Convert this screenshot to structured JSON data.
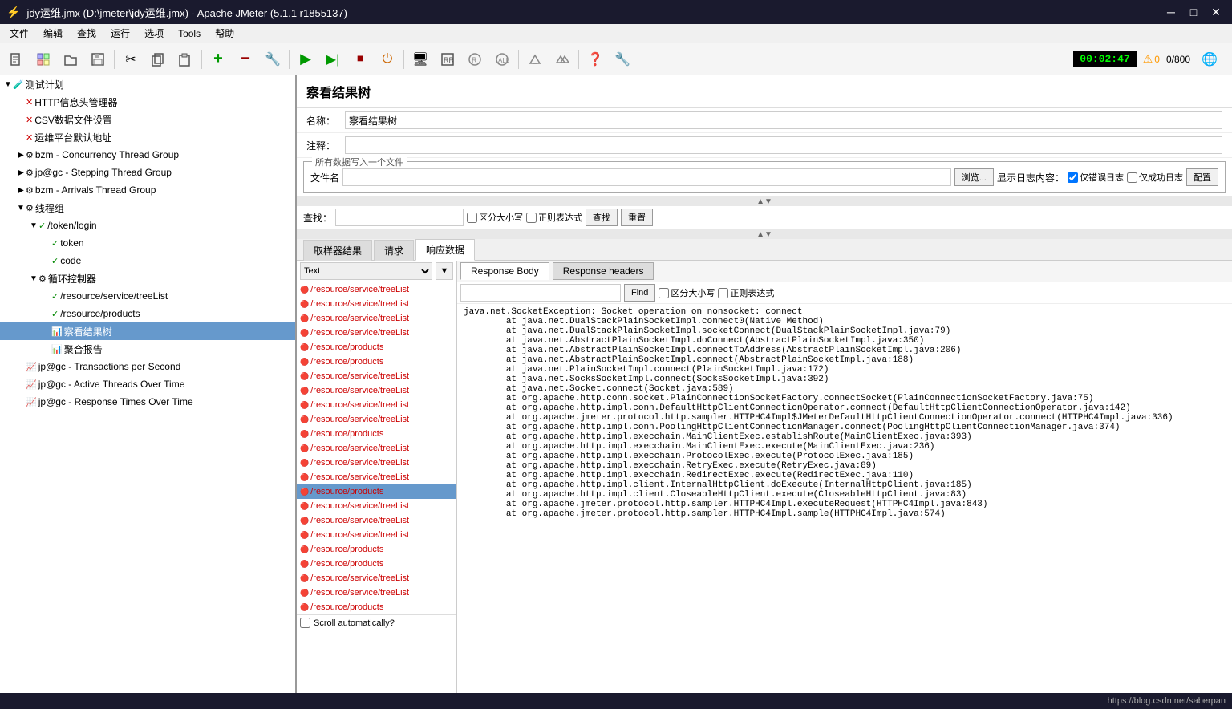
{
  "titleBar": {
    "icon": "⚡",
    "title": "jdy运维.jmx (D:\\jmeter\\jdy运维.jmx) - Apache JMeter (5.1.1 r1855137)",
    "minimize": "─",
    "maximize": "□",
    "close": "✕"
  },
  "menuBar": {
    "items": [
      "文件",
      "编辑",
      "查找",
      "运行",
      "选项",
      "Tools",
      "帮助"
    ]
  },
  "toolbar": {
    "timer": "00:02:47",
    "warningCount": "0",
    "counter": "0/800"
  },
  "sidebar": {
    "items": [
      {
        "id": "test-plan",
        "label": "测试计划",
        "level": 0,
        "icon": "🧪",
        "expanded": true
      },
      {
        "id": "http-header",
        "label": "HTTP信息头管理器",
        "level": 1,
        "icon": "✕",
        "type": "error"
      },
      {
        "id": "csv-data",
        "label": "CSV数据文件设置",
        "level": 1,
        "icon": "✕",
        "type": "error"
      },
      {
        "id": "user-defaults",
        "label": "运维平台默认地址",
        "level": 1,
        "icon": "✕",
        "type": "error"
      },
      {
        "id": "bzm-concurrency",
        "label": "bzm - Concurrency Thread Group",
        "level": 1,
        "icon": "⚙",
        "expanded": false
      },
      {
        "id": "jp-stepping",
        "label": "jp@gc - Stepping Thread Group",
        "level": 1,
        "icon": "⚙",
        "expanded": false
      },
      {
        "id": "bzm-arrivals",
        "label": "bzm - Arrivals Thread Group",
        "level": 1,
        "icon": "⚙",
        "expanded": false
      },
      {
        "id": "thread-group",
        "label": "线程组",
        "level": 1,
        "icon": "⚙",
        "expanded": true
      },
      {
        "id": "token-login",
        "label": "/token/login",
        "level": 2,
        "icon": "✓",
        "expanded": true,
        "type": "success"
      },
      {
        "id": "token",
        "label": "token",
        "level": 3,
        "icon": "✓",
        "type": "success"
      },
      {
        "id": "code",
        "label": "code",
        "level": 3,
        "icon": "✓",
        "type": "success"
      },
      {
        "id": "loop-controller",
        "label": "循环控制器",
        "level": 2,
        "icon": "⚙",
        "expanded": true
      },
      {
        "id": "resource-treelist",
        "label": "/resource/service/treeList",
        "level": 3,
        "icon": "✓",
        "type": "success"
      },
      {
        "id": "resource-products",
        "label": "/resource/products",
        "level": 3,
        "icon": "✓",
        "type": "success"
      },
      {
        "id": "view-results-tree",
        "label": "察看结果树",
        "level": 3,
        "icon": "📊",
        "selected": true
      },
      {
        "id": "summary-report",
        "label": "聚合报告",
        "level": 3,
        "icon": "📊"
      },
      {
        "id": "jp-tps",
        "label": "jp@gc - Transactions per Second",
        "level": 1,
        "icon": "📈"
      },
      {
        "id": "jp-active",
        "label": "jp@gc - Active Threads Over Time",
        "level": 1,
        "icon": "📈"
      },
      {
        "id": "jp-response",
        "label": "jp@gc - Response Times Over Time",
        "level": 1,
        "icon": "📈"
      }
    ]
  },
  "panel": {
    "title": "察看结果树",
    "nameLabel": "名称：",
    "nameValue": "察看结果树",
    "commentLabel": "注释：",
    "commentValue": "",
    "fileSection": {
      "title": "所有数据写入一个文件",
      "fileLabel": "文件名",
      "browseBtn": "浏览...",
      "logBtn": "显示日志内容：",
      "onlyErrorsLabel": "仅错误日志",
      "onlySuccessLabel": "仅成功日志",
      "configBtn": "配置"
    },
    "search": {
      "label": "查找：",
      "placeholder": "",
      "caseLabel": "区分大小写",
      "regexLabel": "正则表达式",
      "findBtn": "查找",
      "resetBtn": "重置"
    }
  },
  "resultsPane": {
    "tabs": [
      {
        "id": "sampler",
        "label": "取样器结果"
      },
      {
        "id": "request",
        "label": "请求"
      },
      {
        "id": "response",
        "label": "响应数据",
        "active": true
      }
    ],
    "filterLabel": "Text",
    "detailTabs": [
      {
        "id": "body",
        "label": "Response Body",
        "active": true
      },
      {
        "id": "headers",
        "label": "Response headers"
      }
    ],
    "searchRow": {
      "findBtn": "Find",
      "caseLabel": "区分大小写",
      "regexLabel": "正则表达式"
    },
    "items": [
      "/resource/service/treeList",
      "/resource/service/treeList",
      "/resource/service/treeList",
      "/resource/service/treeList",
      "/resource/products",
      "/resource/products",
      "/resource/service/treeList",
      "/resource/service/treeList",
      "/resource/service/treeList",
      "/resource/service/treeList",
      "/resource/products",
      "/resource/service/treeList",
      "/resource/service/treeList",
      "/resource/service/treeList",
      "/resource/products",
      "/resource/service/treeList",
      "/resource/service/treeList",
      "/resource/service/treeList",
      "/resource/products",
      "/resource/products",
      "/resource/service/treeList",
      "/resource/service/treeList",
      "/resource/products"
    ],
    "selectedItem": 14,
    "scrollAuto": "Scroll automatically?",
    "errorContent": "java.net.SocketException: Socket operation on nonsocket: connect\n\tat java.net.DualStackPlainSocketImpl.connect0(Native Method)\n\tat java.net.DualStackPlainSocketImpl.socketConnect(DualStackPlainSocketImpl.java:79)\n\tat java.net.AbstractPlainSocketImpl.doConnect(AbstractPlainSocketImpl.java:350)\n\tat java.net.AbstractPlainSocketImpl.connectToAddress(AbstractPlainSocketImpl.java:206)\n\tat java.net.AbstractPlainSocketImpl.connect(AbstractPlainSocketImpl.java:188)\n\tat java.net.PlainSocketImpl.connect(PlainSocketImpl.java:172)\n\tat java.net.SocksSocketImpl.connect(SocksSocketImpl.java:392)\n\tat java.net.Socket.connect(Socket.java:589)\n\tat org.apache.http.conn.socket.PlainConnectionSocketFactory.connectSocket(PlainConnectionSocketFactory.java:75)\n\tat org.apache.http.impl.conn.DefaultHttpClientConnectionOperator.connect(DefaultHttpClientConnectionOperator.java:142)\n\tat org.apache.jmeter.protocol.http.sampler.HTTPHC4Impl$JMeterDefaultHttpClientConnectionOperator.connect(HTTPHC4Impl.java:336)\n\tat org.apache.http.impl.conn.PoolingHttpClientConnectionManager.connect(PoolingHttpClientConnectionManager.java:374)\n\tat org.apache.http.impl.execchain.MainClientExec.establishRoute(MainClientExec.java:393)\n\tat org.apache.http.impl.execchain.MainClientExec.execute(MainClientExec.java:236)\n\tat org.apache.http.impl.execchain.ProtocolExec.execute(ProtocolExec.java:185)\n\tat org.apache.http.impl.execchain.RetryExec.execute(RetryExec.java:89)\n\tat org.apache.http.impl.execchain.RedirectExec.execute(RedirectExec.java:110)\n\tat org.apache.http.impl.client.InternalHttpClient.doExecute(InternalHttpClient.java:185)\n\tat org.apache.http.impl.client.CloseableHttpClient.execute(CloseableHttpClient.java:83)\n\tat org.apache.jmeter.protocol.http.sampler.HTTPHC4Impl.executeRequest(HTTPHC4Impl.java:843)\n\tat org.apache.jmeter.protocol.http.sampler.HTTPHC4Impl.sample(HTTPHC4Impl.java:574)"
  },
  "statusBar": {
    "url": "https://blog.csdn.net/saberpan"
  }
}
